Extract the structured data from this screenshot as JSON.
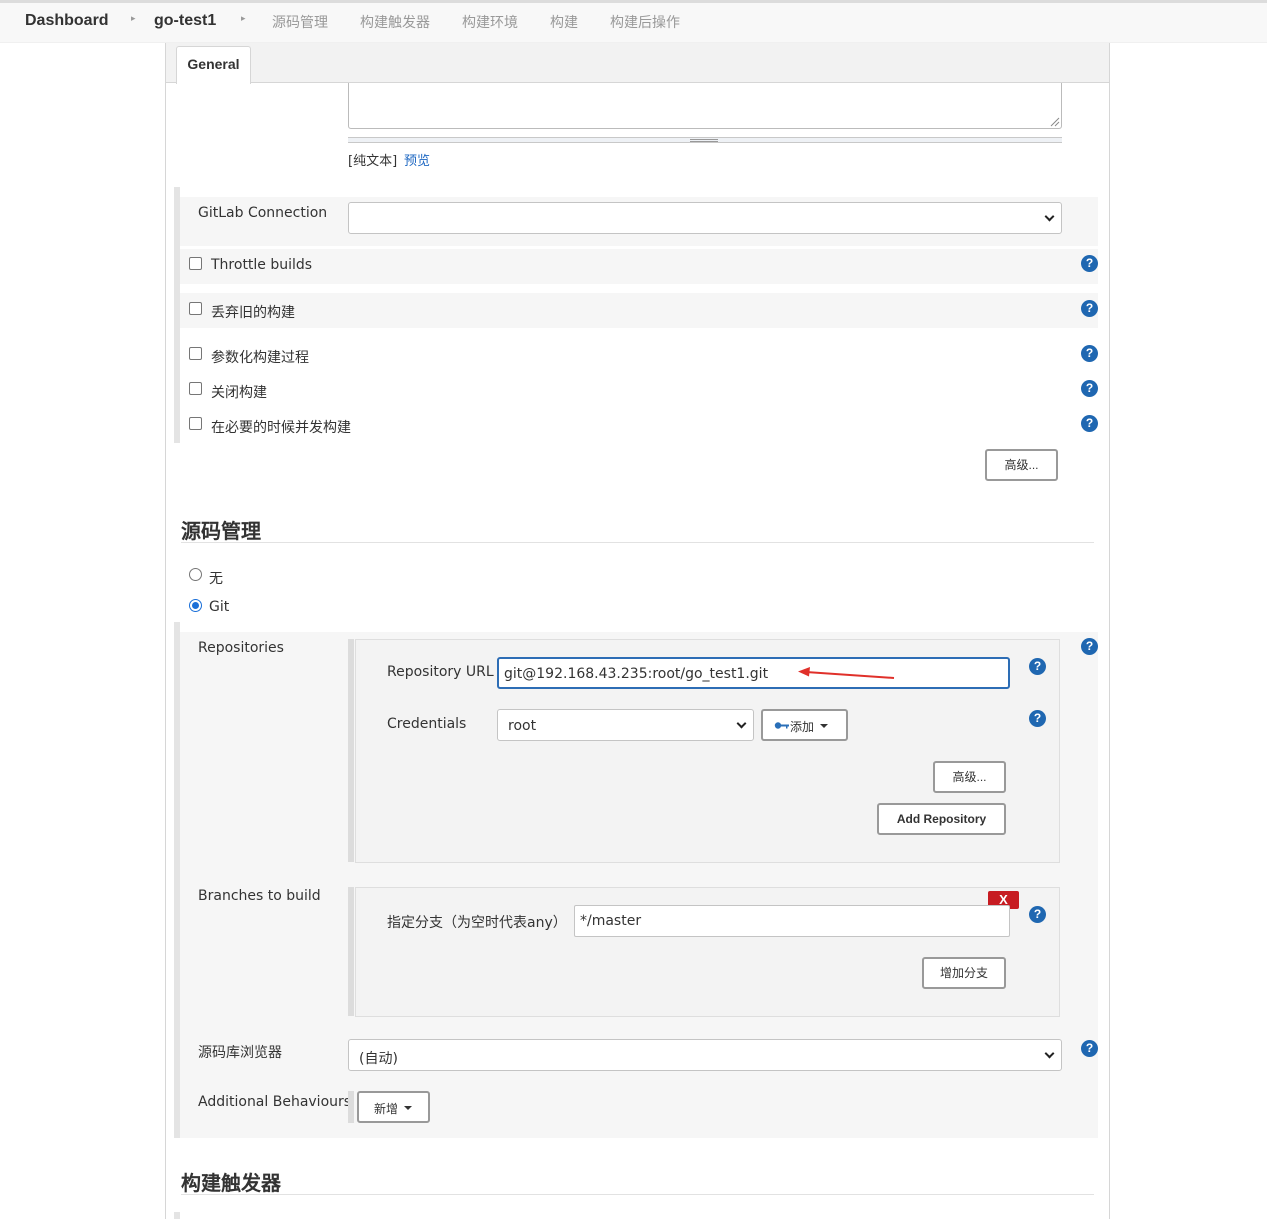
{
  "breadcrumb": {
    "items": [
      "Dashboard",
      "go-test1"
    ]
  },
  "tabs": {
    "general": "General",
    "scm": "源码管理",
    "triggers": "构建触发器",
    "env": "构建环境",
    "build": "构建",
    "post": "构建后操作"
  },
  "description": {
    "plain_text": "[纯文本]",
    "preview": "预览"
  },
  "general": {
    "gitlab_label": "GitLab Connection",
    "gitlab_value": "",
    "throttle": "Throttle builds",
    "discard": "丢弃旧的构建",
    "parameterized": "参数化构建过程",
    "disable": "关闭构建",
    "concurrent": "在必要的时候并发构建",
    "advanced": "高级..."
  },
  "scm": {
    "title": "源码管理",
    "none": "无",
    "git": "Git",
    "repositories_label": "Repositories",
    "repo_url_label": "Repository URL",
    "repo_url_value": "git@192.168.43.235:root/go_test1.git",
    "credentials_label": "Credentials",
    "credentials_value": "root",
    "add_label": "添加",
    "advanced": "高级...",
    "add_repository": "Add Repository",
    "branches_label": "Branches to build",
    "branch_spec_label": "指定分支（为空时代表any）",
    "branch_spec_value": "*/master",
    "delete": "X",
    "add_branch": "增加分支",
    "browser_label": "源码库浏览器",
    "browser_value": "(自动)",
    "behaviours_label": "Additional Behaviours",
    "behaviours_add": "新增"
  },
  "triggers": {
    "title": "构建触发器"
  },
  "colors": {
    "help": "#1f67b1",
    "link": "#1d67c2",
    "delete": "#c71c22",
    "annotation_arrow": "#e0302a"
  }
}
